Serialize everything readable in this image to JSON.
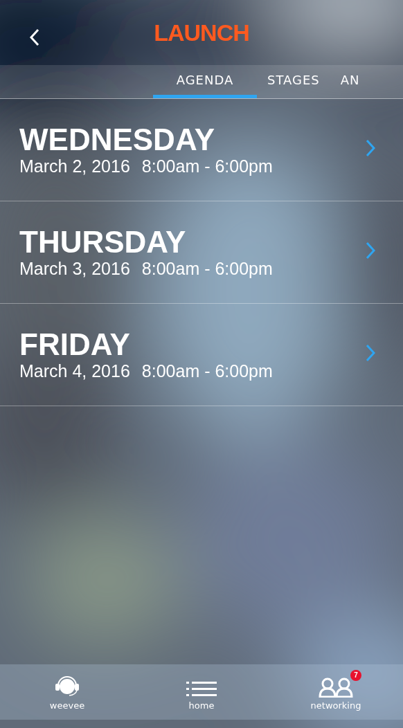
{
  "header": {
    "logo": "LAUNCH"
  },
  "tabs": [
    {
      "label": "AGENDA",
      "selected": true
    },
    {
      "label": "STAGES",
      "selected": false
    },
    {
      "label": "AN",
      "selected": false
    }
  ],
  "days": [
    {
      "day": "WEDNESDAY",
      "date": "March 2, 2016",
      "hours": "8:00am - 6:00pm"
    },
    {
      "day": "THURSDAY",
      "date": "March 3, 2016",
      "hours": "8:00am - 6:00pm"
    },
    {
      "day": "FRIDAY",
      "date": "March 4, 2016",
      "hours": "8:00am - 6:00pm"
    }
  ],
  "bottom_nav": [
    {
      "kind": "assistant",
      "label": "weevee"
    },
    {
      "kind": "home",
      "label": "home"
    },
    {
      "kind": "networking",
      "label": "networking",
      "badge": "7"
    }
  ]
}
